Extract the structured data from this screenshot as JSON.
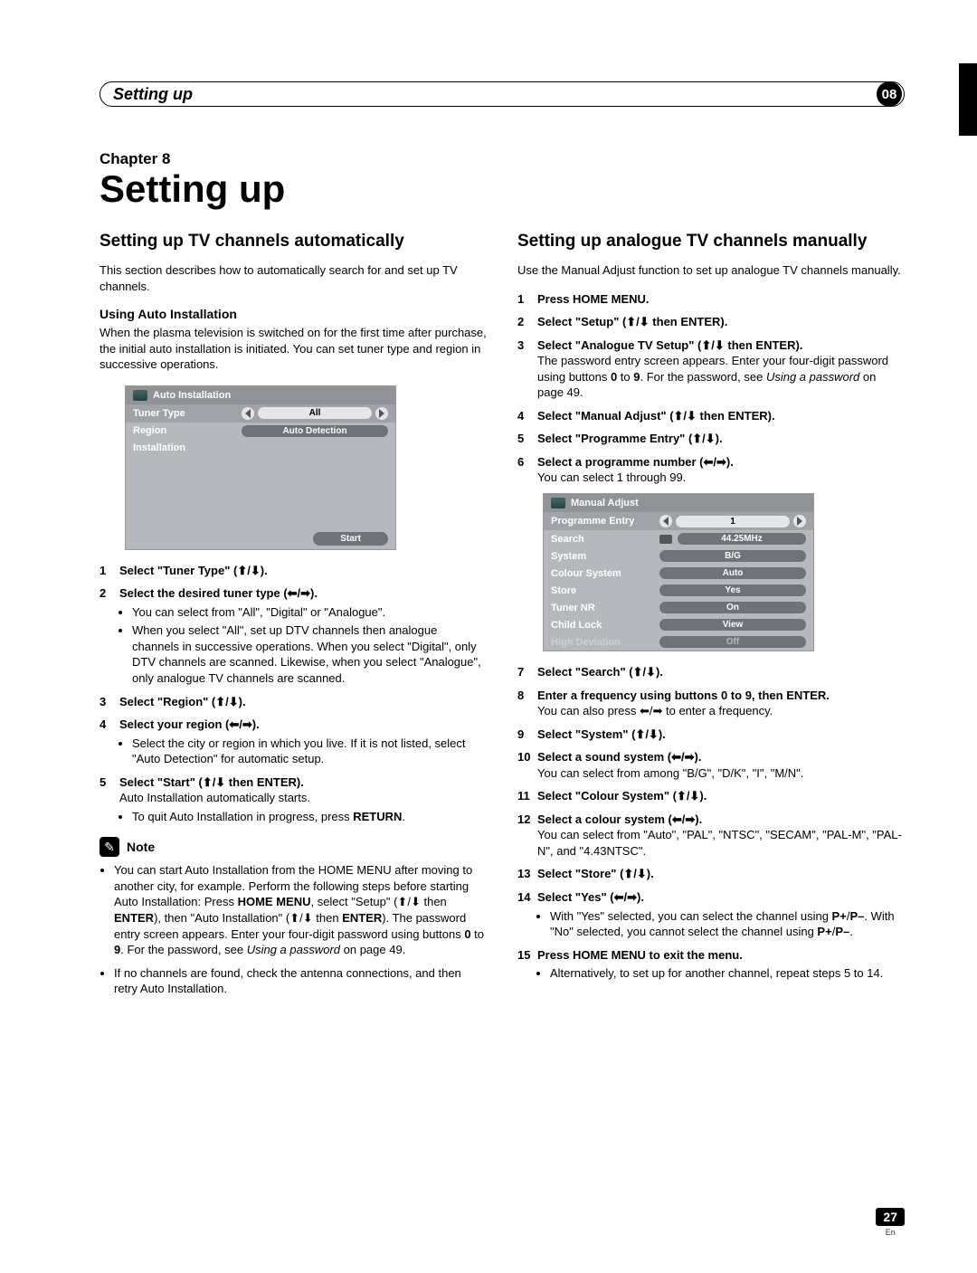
{
  "header": {
    "section": "Setting up",
    "badge": "08"
  },
  "chapter_label": "Chapter 8",
  "page_title": "Setting up",
  "page_number": "27",
  "page_lang": "En",
  "arrows": {
    "up": "⬆",
    "down": "⬇",
    "left": "⬅",
    "right": "➡",
    "ud": "⬆/⬇",
    "lr": "⬅/➡"
  },
  "left": {
    "title": "Setting up TV channels automatically",
    "intro": "This section describes how to automatically search for and set up TV channels.",
    "sub1": "Using Auto Installation",
    "sub1_body": "When the plasma television is switched on for the first time after purchase, the initial auto installation is initiated. You can set tuner type and region in successive operations.",
    "osd": {
      "title": "Auto Installation",
      "rows": [
        {
          "label": "Tuner Type",
          "value": "All",
          "selected": true,
          "arrows": true
        },
        {
          "label": "Region",
          "value": "Auto Detection",
          "arrows": false
        },
        {
          "label": "Installation",
          "value": "",
          "arrows": false
        }
      ],
      "start": "Start"
    },
    "steps": [
      {
        "t": "Select \"Tuner Type\" (⬆/⬇)."
      },
      {
        "t": "Select the desired tuner type (⬅/➡).",
        "subs": [
          "You can select from \"All\", \"Digital\" or \"Analogue\".",
          "When you select \"All\", set up DTV channels then analogue channels in successive operations. When you select \"Digital\", only DTV channels are scanned. Likewise, when you select \"Analogue\", only analogue TV channels are scanned."
        ]
      },
      {
        "t": "Select \"Region\" (⬆/⬇)."
      },
      {
        "t": "Select your region (⬅/➡).",
        "subs": [
          "Select the city or region in which you live. If it is not listed, select \"Auto Detection\" for automatic setup."
        ]
      },
      {
        "t": "Select \"Start\" (⬆/⬇ then ENTER).",
        "body": "Auto Installation automatically starts.",
        "subs": [
          "To quit Auto Installation in progress, press RETURN."
        ]
      }
    ],
    "note_label": "Note",
    "notes": [
      "You can start Auto Installation from the HOME MENU after moving to another city, for example. Perform the following steps before starting Auto Installation: Press HOME MENU, select \"Setup\" (⬆/⬇ then ENTER), then \"Auto Installation\" (⬆/⬇ then ENTER). The password entry screen appears. Enter your four-digit password using buttons 0 to 9. For the password, see Using a password on page 49.",
      "If no channels are found, check the antenna connections, and then retry Auto Installation."
    ]
  },
  "right": {
    "title": "Setting up analogue TV channels manually",
    "intro": "Use the Manual Adjust function to set up analogue TV channels manually.",
    "steps_a": [
      {
        "n": "1",
        "t": "Press HOME MENU."
      },
      {
        "n": "2",
        "t": "Select \"Setup\" (⬆/⬇ then ENTER)."
      },
      {
        "n": "3",
        "t": "Select \"Analogue TV Setup\" (⬆/⬇ then ENTER).",
        "body": "The password entry screen appears. Enter your four-digit password using buttons 0 to 9. For the password, see Using a password on page 49."
      },
      {
        "n": "4",
        "t": "Select \"Manual Adjust\" (⬆/⬇ then ENTER)."
      },
      {
        "n": "5",
        "t": "Select \"Programme Entry\" (⬆/⬇)."
      },
      {
        "n": "6",
        "t": "Select a programme number (⬅/➡).",
        "body": "You can select 1 through 99."
      }
    ],
    "osd": {
      "title": "Manual Adjust",
      "rows": [
        {
          "label": "Programme Entry",
          "value": "1",
          "arrows": true,
          "selected": true
        },
        {
          "label": "Search",
          "value": "44.25MHz",
          "kbd": true
        },
        {
          "label": "System",
          "value": "B/G"
        },
        {
          "label": "Colour System",
          "value": "Auto"
        },
        {
          "label": "Store",
          "value": "Yes"
        },
        {
          "label": "Tuner NR",
          "value": "On"
        },
        {
          "label": "Child Lock",
          "value": "View"
        },
        {
          "label": "High Deviation",
          "value": "Off",
          "dim": true
        }
      ]
    },
    "steps_b": [
      {
        "n": "7",
        "t": "Select \"Search\" (⬆/⬇)."
      },
      {
        "n": "8",
        "t": "Enter a frequency using buttons 0 to 9, then ENTER.",
        "body": "You can also press ⬅/➡ to enter a frequency."
      },
      {
        "n": "9",
        "t": "Select \"System\" (⬆/⬇)."
      },
      {
        "n": "10",
        "t": "Select a sound system (⬅/➡).",
        "body": "You can select from among \"B/G\", \"D/K\", \"I\", \"M/N\"."
      },
      {
        "n": "11",
        "t": "Select \"Colour System\" (⬆/⬇)."
      },
      {
        "n": "12",
        "t": "Select a colour system (⬅/➡).",
        "body": "You can select from \"Auto\", \"PAL\", \"NTSC\", \"SECAM\", \"PAL-M\", \"PAL-N\", and \"4.43NTSC\"."
      },
      {
        "n": "13",
        "t": "Select \"Store\" (⬆/⬇)."
      },
      {
        "n": "14",
        "t": "Select \"Yes\" (⬅/➡).",
        "subs": [
          "With \"Yes\" selected, you can select the channel using P+/P–. With \"No\" selected, you cannot select the channel using P+/P–."
        ]
      },
      {
        "n": "15",
        "t": "Press HOME MENU to exit the menu.",
        "subs": [
          "Alternatively, to set up for another channel, repeat steps 5 to 14."
        ]
      }
    ]
  }
}
